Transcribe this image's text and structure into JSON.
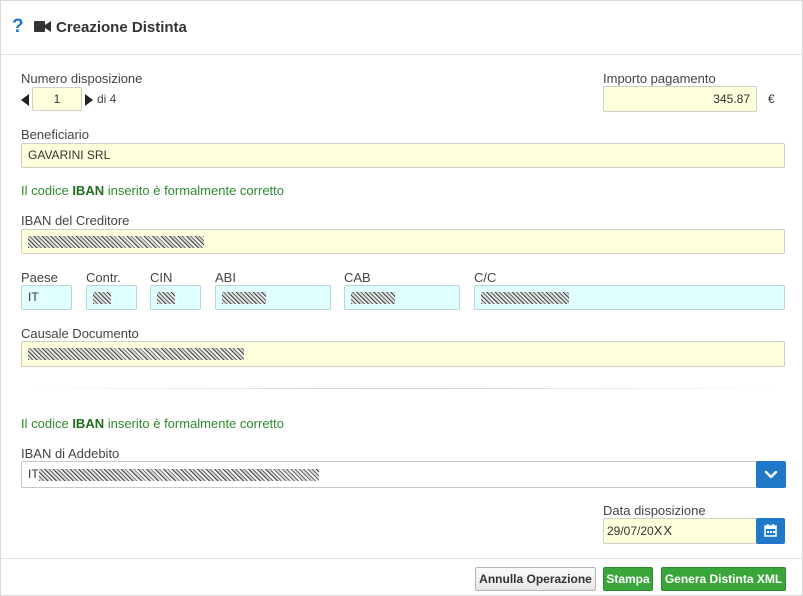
{
  "header": {
    "help_icon": "question-icon",
    "video_icon": "video-camera-icon",
    "title": "Creazione Distinta"
  },
  "disposition": {
    "label": "Numero disposizione",
    "value": "1",
    "of_text": "di 4"
  },
  "amount": {
    "label": "Importo pagamento",
    "value": "345.87",
    "currency": "€"
  },
  "beneficiary": {
    "label": "Beneficiario",
    "value": "GAVARINI SRL"
  },
  "iban_check_1": {
    "prefix": "Il codice ",
    "bold": "IBAN",
    "suffix": " inserito è formalmente corretto"
  },
  "creditor_iban": {
    "label": "IBAN del Creditore"
  },
  "iban_parts": {
    "paese_label": "Paese",
    "paese_value": "IT",
    "contr_label": "Contr.",
    "cin_label": "CIN",
    "abi_label": "ABI",
    "cab_label": "CAB",
    "cc_label": "C/C"
  },
  "causale": {
    "label": "Causale Documento"
  },
  "iban_check_2": {
    "prefix": "Il codice ",
    "bold": "IBAN",
    "suffix": " inserito è formalmente corretto"
  },
  "debit_iban": {
    "label": "IBAN di Addebito",
    "value_prefix": "IT"
  },
  "date": {
    "label": "Data disposizione",
    "value_visible": "29/07/20",
    "value_masked": "XX"
  },
  "footer": {
    "cancel_label": "Annulla Operazione",
    "print_label": "Stampa",
    "generate_label": "Genera Distinta XML"
  },
  "colors": {
    "accent": "#1f78c8",
    "success": "#2e8b2e",
    "field_yellow": "#ffffdd",
    "field_cyan": "#e0ffff"
  }
}
